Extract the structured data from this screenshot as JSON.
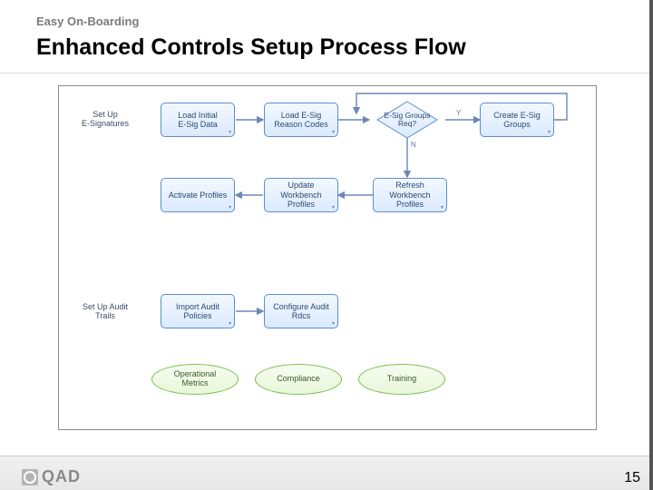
{
  "breadcrumb": "Easy On-Boarding",
  "title": "Enhanced Controls Setup Process Flow",
  "labels": {
    "esig_section": "Set Up\nE-Signatures",
    "audit_section": "Set Up Audit\nTrails"
  },
  "boxes": {
    "load_initial": "Load Initial\nE-Sig Data",
    "reason_codes": "Load E-Sig\nReason Codes",
    "create_groups": "Create E-Sig\nGroups",
    "activate": "Activate Profiles",
    "update_wb": "Update\nWorkbench\nProfiles",
    "refresh_wb": "Refresh\nWorkbench\nProfiles",
    "import_audit": "Import Audit\nPolicies",
    "configure_rdcs": "Configure Audit\nRdcs"
  },
  "decision": {
    "groups_req": "E-Sig Groups\nReq?",
    "yes": "Y",
    "no": "N"
  },
  "ellipses": {
    "operational": "Operational\nMetrics",
    "compliance": "Compliance",
    "training": "Training"
  },
  "logo_text": "QAD",
  "page_number": "15"
}
